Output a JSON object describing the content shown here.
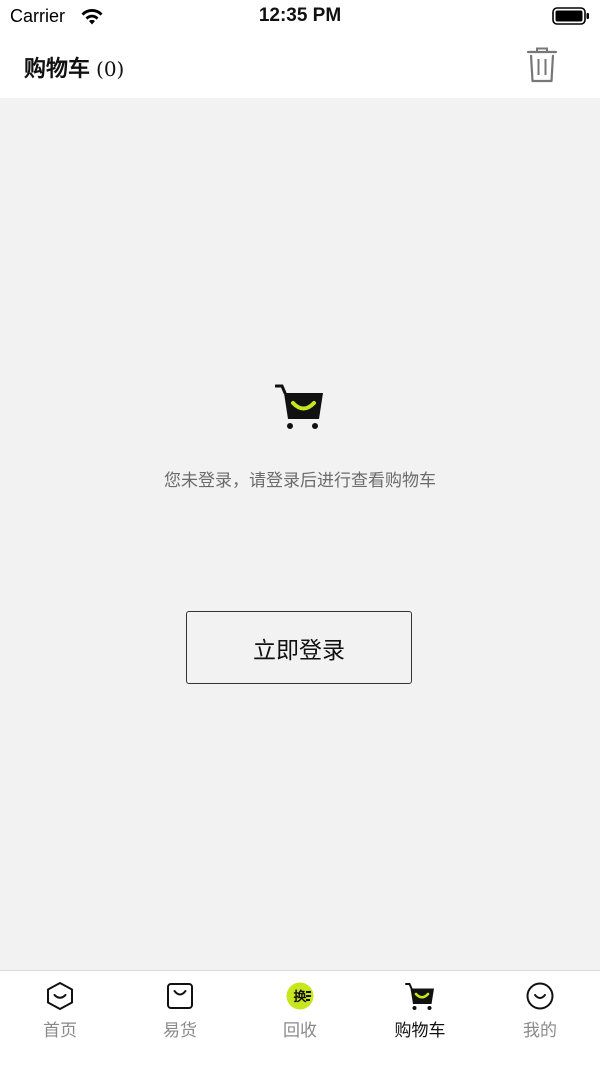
{
  "status_bar": {
    "carrier": "Carrier",
    "time": "12:35 PM",
    "icons": [
      "wifi-icon",
      "battery-icon"
    ]
  },
  "header": {
    "title": "购物车",
    "count": "(0)",
    "trash_icon": "trash-icon"
  },
  "empty_state": {
    "icon": "shopping-cart-icon",
    "message": "您未登录，请登录后进行查看购物车",
    "login_button": "立即登录"
  },
  "tab_bar": {
    "items": [
      {
        "label": "首页",
        "icon": "home-hexagon-icon",
        "active": false
      },
      {
        "label": "易货",
        "icon": "shopping-bag-icon",
        "active": false
      },
      {
        "label": "回收",
        "icon": "exchange-badge-icon",
        "active": false
      },
      {
        "label": "购物车",
        "icon": "cart-icon",
        "active": true
      },
      {
        "label": "我的",
        "icon": "smiley-icon",
        "active": false
      }
    ]
  },
  "colors": {
    "accent": "#c8e61e",
    "background": "#f2f2f2",
    "text_muted": "#8a8a8a"
  }
}
